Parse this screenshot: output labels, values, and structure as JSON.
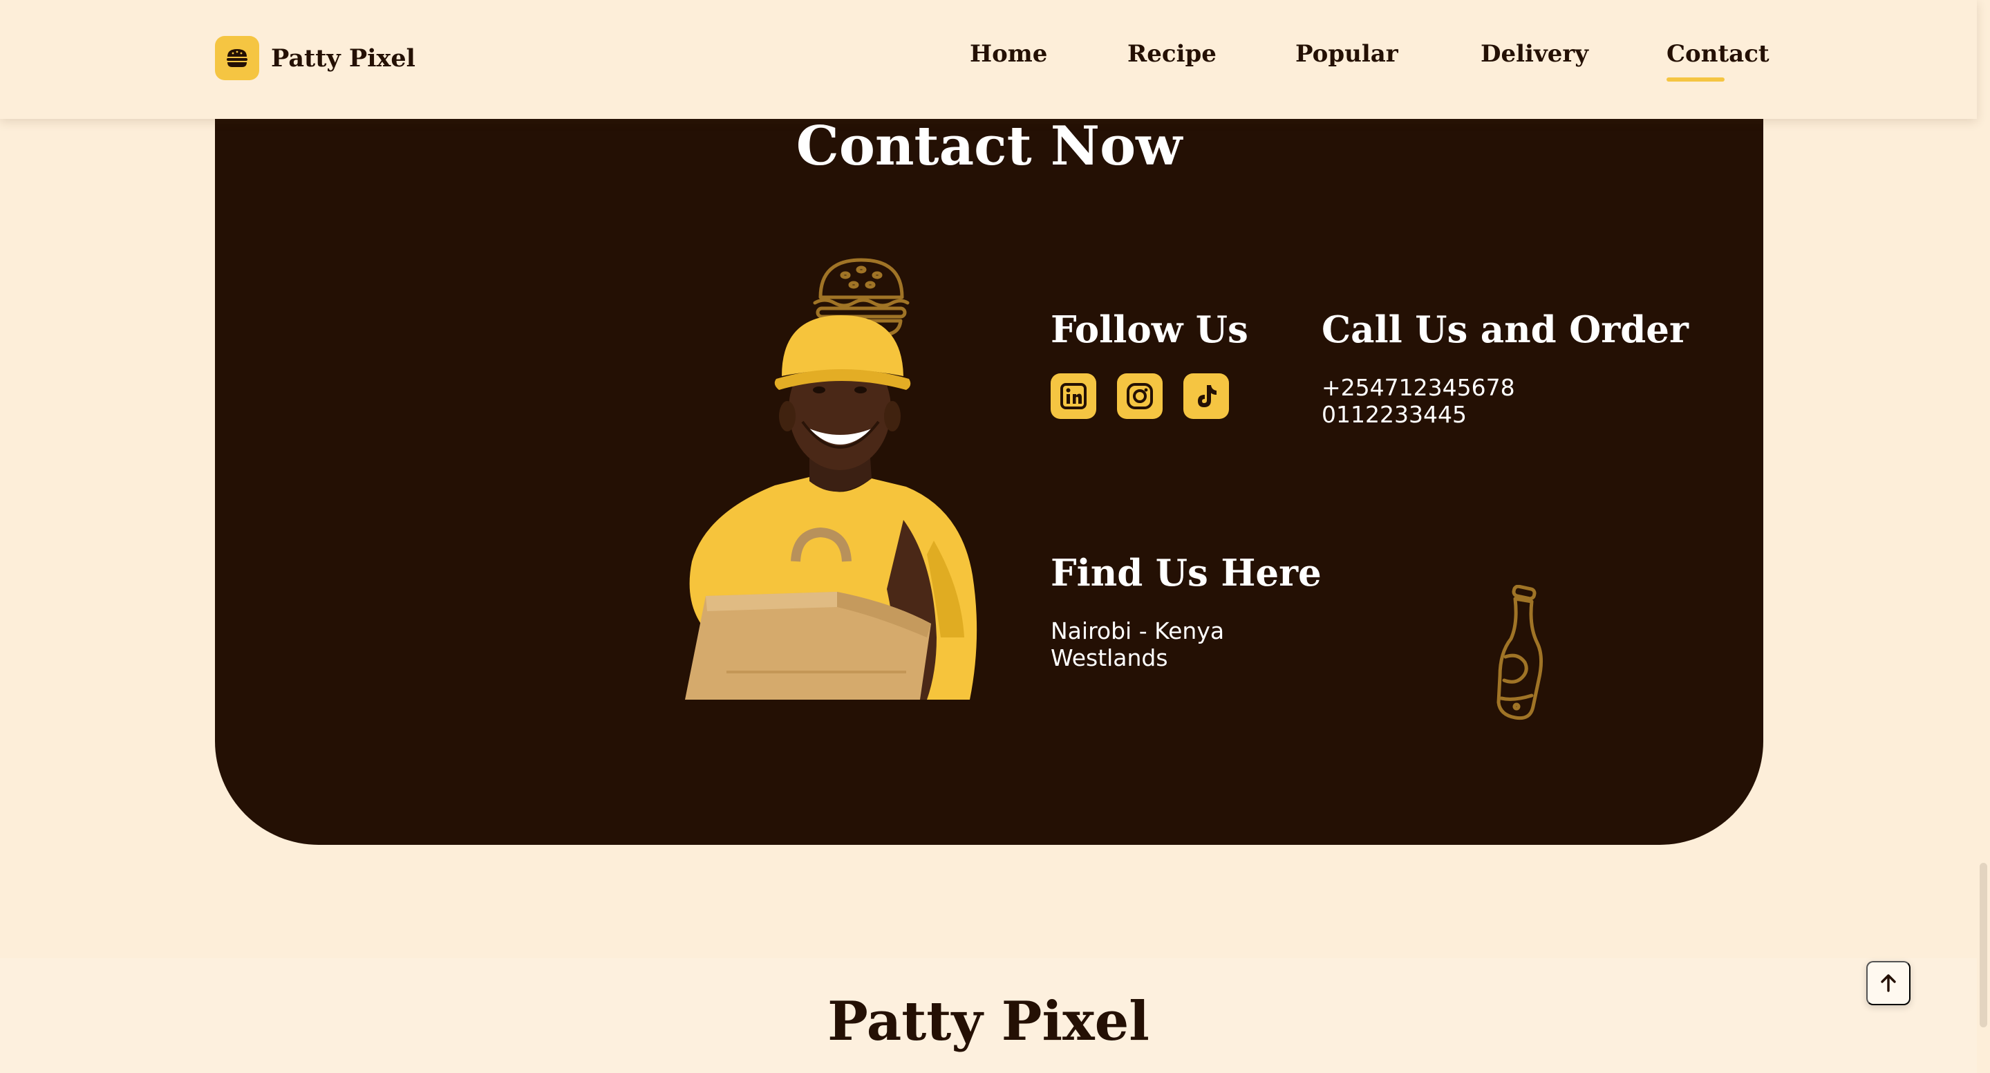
{
  "brand": {
    "name": "Patty Pixel",
    "logo_icon": "burger-icon",
    "accent_color": "#f5c542",
    "dark_color": "#241004",
    "background_color": "#fdeed9"
  },
  "nav": {
    "items": [
      {
        "label": "Home"
      },
      {
        "label": "Recipe"
      },
      {
        "label": "Popular"
      },
      {
        "label": "Delivery"
      },
      {
        "label": "Contact",
        "active": true
      }
    ]
  },
  "contact": {
    "title": "Contact Now",
    "follow": {
      "heading": "Follow Us",
      "icons": [
        "linkedin-icon",
        "instagram-icon",
        "tiktok-icon"
      ]
    },
    "call": {
      "heading": "Call Us and Order",
      "phones": [
        "+254712345678",
        "0112233445"
      ]
    },
    "find": {
      "heading": "Find Us Here",
      "lines": [
        "Nairobi - Kenya",
        "Westlands"
      ]
    },
    "illustrations": [
      "delivery-man-image",
      "burger-outline-icon",
      "soda-bottle-outline-icon"
    ]
  },
  "footer": {
    "title": "Patty Pixel"
  },
  "controls": {
    "scroll_top_icon": "arrow-up-icon"
  }
}
